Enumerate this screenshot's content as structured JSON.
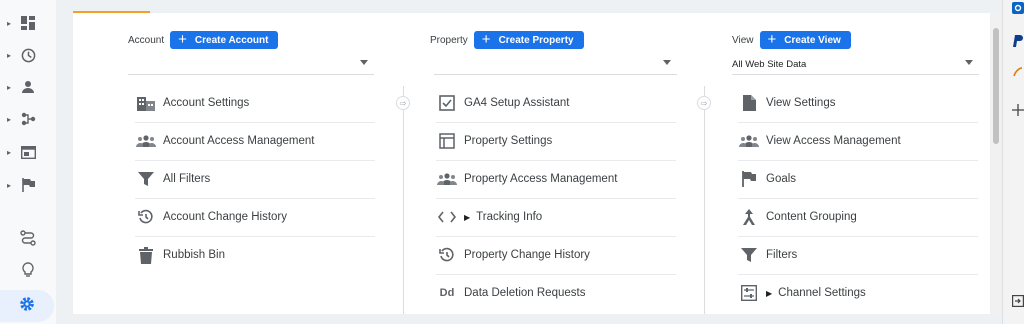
{
  "rail": {
    "items": [
      {
        "name": "home-dashboard-icon",
        "caret": "▸"
      },
      {
        "name": "realtime-clock-icon",
        "caret": "▸"
      },
      {
        "name": "audience-person-icon",
        "caret": "▸"
      },
      {
        "name": "acquisition-icon",
        "caret": "▸"
      },
      {
        "name": "behaviour-icon",
        "caret": "▸"
      },
      {
        "name": "conversions-flag-icon",
        "caret": "▸"
      }
    ],
    "bottom": [
      "attribution-icon",
      "discover-lightbulb-icon",
      "admin-gear-icon"
    ]
  },
  "account": {
    "label": "Account",
    "create_label": "Create Account",
    "selected": "",
    "items": [
      {
        "icon": "building-icon",
        "label": "Account Settings"
      },
      {
        "icon": "people-icon",
        "label": "Account Access Management"
      },
      {
        "icon": "filter-icon",
        "label": "All Filters"
      },
      {
        "icon": "history-icon",
        "label": "Account Change History"
      },
      {
        "icon": "trash-icon",
        "label": "Rubbish Bin"
      }
    ]
  },
  "property": {
    "label": "Property",
    "create_label": "Create Property",
    "selected": "",
    "items": [
      {
        "icon": "checkbox-icon",
        "label": "GA4 Setup Assistant"
      },
      {
        "icon": "layout-icon",
        "label": "Property Settings"
      },
      {
        "icon": "people-icon",
        "label": "Property Access Management"
      },
      {
        "icon": "code-icon",
        "label": "Tracking Info",
        "expand": "▶"
      },
      {
        "icon": "history-icon",
        "label": "Property Change History"
      },
      {
        "icon": "dd-icon",
        "label": "Data Deletion Requests",
        "glyph": "Dd"
      }
    ]
  },
  "view": {
    "label": "View",
    "create_label": "Create View",
    "selected": "All Web Site Data",
    "items": [
      {
        "icon": "document-icon",
        "label": "View Settings"
      },
      {
        "icon": "people-icon",
        "label": "View Access Management"
      },
      {
        "icon": "flag-icon",
        "label": "Goals"
      },
      {
        "icon": "content-grouping-icon",
        "label": "Content Grouping"
      },
      {
        "icon": "filter-icon",
        "label": "Filters"
      },
      {
        "icon": "channel-settings-icon",
        "label": "Channel Settings",
        "expand": "▶"
      }
    ]
  },
  "plus_glyph": "+",
  "arrow_glyph": "⇨",
  "colors": {
    "accent": "#1a73e8",
    "tab_indicator": "#f6a021"
  }
}
